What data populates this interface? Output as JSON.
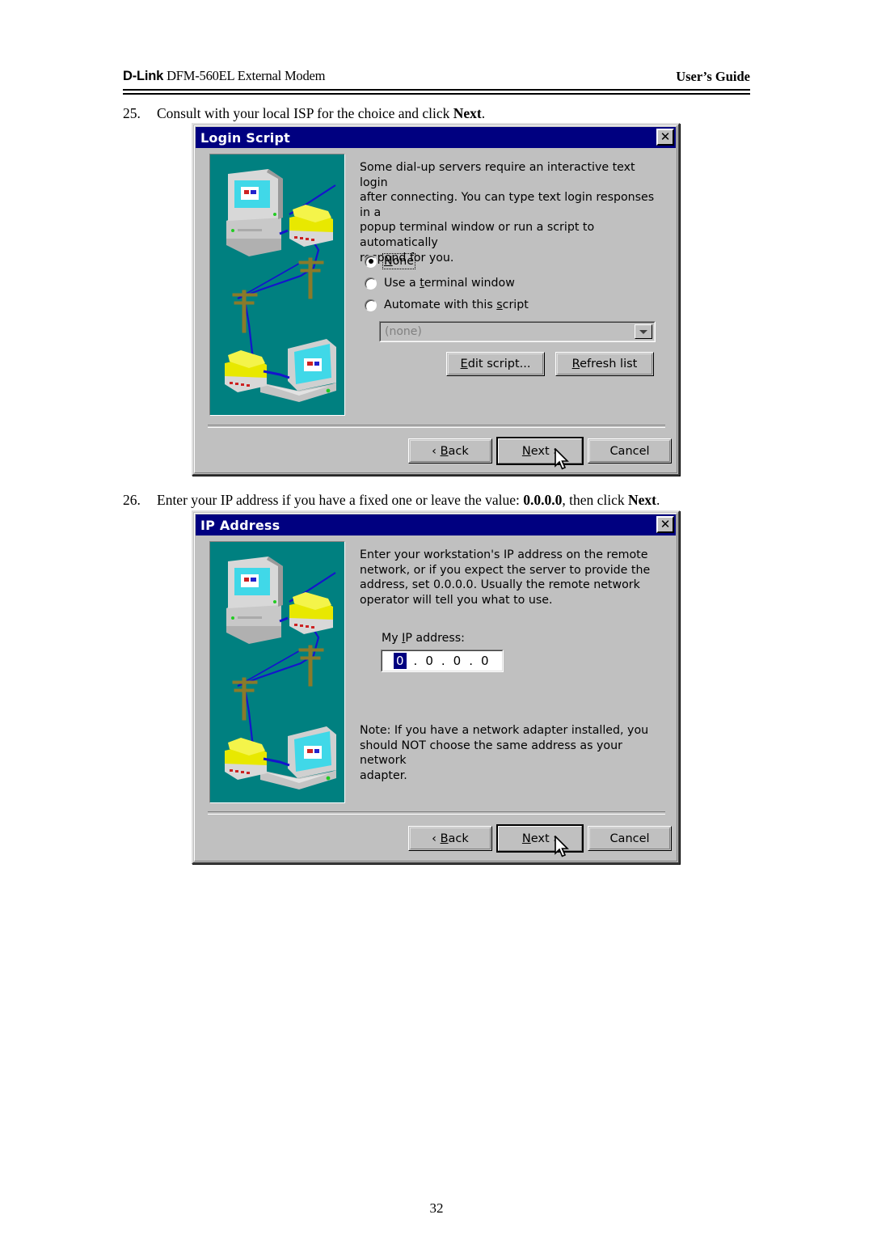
{
  "header": {
    "left_bold": "D-Link",
    "left_rest": " DFM-560EL External Modem",
    "right": "User’s Guide"
  },
  "steps": [
    {
      "number": "25.",
      "text_before": "Consult with your local ISP for the choice and click ",
      "text_bold": "Next",
      "text_after": "."
    },
    {
      "number": "26.",
      "text_before": "Enter your IP address if you have a fixed one or leave the value: ",
      "text_bold": "0.0.0.0",
      "text_mid": ", then click ",
      "text_bold2": "Next",
      "text_after": "."
    }
  ],
  "dialog_login_script": {
    "title": "Login Script",
    "close_glyph": "✕",
    "body_text": "Some dial-up servers require an interactive text login\nafter connecting.  You can type text login responses in a\npopup terminal window or run a script to automatically\nrespond for you.",
    "radios": [
      {
        "label_pre": "",
        "label_accel": "N",
        "label_post": "one",
        "checked": true,
        "focused": true
      },
      {
        "label_pre": "Use a ",
        "label_accel": "t",
        "label_post": "erminal window",
        "checked": false,
        "focused": false
      },
      {
        "label_pre": "Automate with this ",
        "label_accel": "s",
        "label_post": "cript",
        "checked": false,
        "focused": false
      }
    ],
    "combo_value": "(none)",
    "buttons": [
      {
        "name": "edit-script",
        "accel": "E",
        "pre": "",
        "post": "dit script..."
      },
      {
        "name": "refresh-list",
        "accel": "R",
        "pre": "",
        "post": "efresh list"
      }
    ],
    "nav_buttons": [
      {
        "name": "back",
        "pre": "‹ ",
        "accel": "B",
        "post": "ack",
        "default": false
      },
      {
        "name": "next",
        "pre": "",
        "accel": "N",
        "post": "ext ›",
        "default": true
      },
      {
        "name": "cancel",
        "pre": "Cancel",
        "accel": "",
        "post": "",
        "default": false
      }
    ]
  },
  "dialog_ip_address": {
    "title": "IP Address",
    "close_glyph": "✕",
    "body_text": "Enter your workstation's IP address on the remote\nnetwork, or if you expect the server to provide the\naddress, set 0.0.0.0.  Usually the remote network\noperator will tell you what to use.",
    "ip_label_pre": "My ",
    "ip_label_accel": "I",
    "ip_label_post": "P address:",
    "ip_octets": [
      "0",
      "0",
      "0",
      "0"
    ],
    "ip_selected_index": 0,
    "note_text": "Note: If you have a network adapter installed, you\nshould NOT choose the same address as your network\nadapter.",
    "nav_buttons": [
      {
        "name": "back",
        "pre": "‹ ",
        "accel": "B",
        "post": "ack",
        "default": false
      },
      {
        "name": "next",
        "pre": "",
        "accel": "N",
        "post": "ext ›",
        "default": true
      },
      {
        "name": "cancel",
        "pre": "Cancel",
        "accel": "",
        "post": "",
        "default": false
      }
    ]
  },
  "illustration": {
    "alt": "network-illustration-computer-phone-poles-laptop",
    "background_color": "#008080",
    "line_color": "#0000cc",
    "phone_color": "#e8e800",
    "screen_color": "#40d8e8"
  },
  "page_number": "32"
}
